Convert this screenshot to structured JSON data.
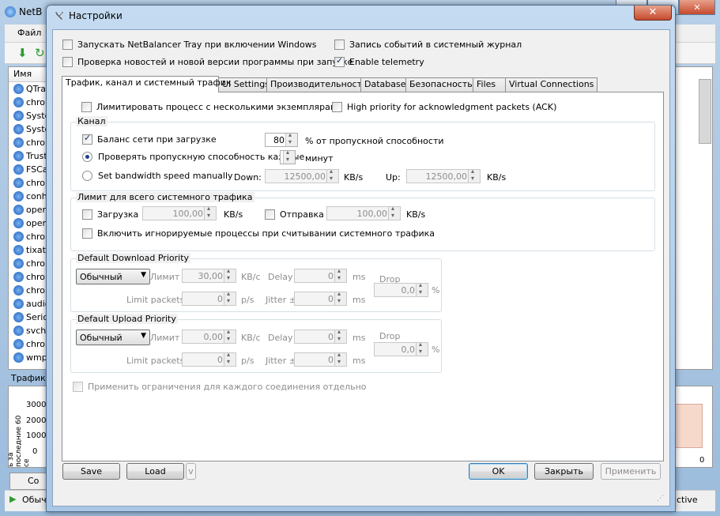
{
  "main_window": {
    "title": "NetB",
    "menu_file": "Файл",
    "list_header": "Имя",
    "processes": [
      "QTra",
      "chron",
      "Syste",
      "Syste",
      "chron",
      "Trust",
      "FSCa",
      "chron",
      "conh",
      "openv",
      "openv",
      "chron",
      "tixati",
      "chron",
      "chron",
      "chron",
      "audio",
      "Serio",
      "svch",
      "chron",
      "wmp"
    ],
    "traffic_label": "Трафик",
    "graph_vlabel": "ь за последние 60 се",
    "graph_ticks": [
      "3000",
      "2000",
      "1000",
      "0"
    ],
    "right_tick": "0",
    "status_left": "Обыч",
    "status_right": "ctive",
    "side_label": "Co"
  },
  "dialog": {
    "title": "Настройки",
    "close_glyph": "✕",
    "top_options": {
      "tray_start": {
        "label": "Запускать NetBalancer Tray при включении Windows",
        "checked": false
      },
      "event_log": {
        "label": "Запись событий в системный журнал",
        "checked": false
      },
      "check_news": {
        "label": "Проверка новостей и новой версии программы при запуске",
        "checked": false
      },
      "telemetry": {
        "label": "Enable telemetry",
        "checked": true
      }
    },
    "tabs": [
      {
        "label": "Трафик, канал и системный трафик",
        "active": true
      },
      {
        "label": "UI Settings",
        "active": false
      },
      {
        "label": "Производительность",
        "active": false
      },
      {
        "label": "Database",
        "active": false
      },
      {
        "label": "Безопасность",
        "active": false
      },
      {
        "label": "Files",
        "active": false
      },
      {
        "label": "Virtual Connections",
        "active": false
      }
    ],
    "tab_content": {
      "limit_multi": "Лимитировать процесс с несколькими экземплярами",
      "high_priority_ack": "High priority for acknowledgment packets (ACK)",
      "channel": {
        "title": "Канал",
        "balance_label": "Баланс сети при загрузке",
        "balance_value": "80",
        "balance_unit": "% от пропускной способности",
        "check_bw_label": "Проверять пропускную способность каждые",
        "check_bw_value": "",
        "check_bw_unit": "минут",
        "manual_label": "Set bandwidth speed manually",
        "down_label": "Down:",
        "down_value": "12500,00",
        "down_unit": "KB/s",
        "up_label": "Up:",
        "up_value": "12500,00",
        "up_unit": "KB/s"
      },
      "system_limit": {
        "title": "Лимит для всего системного трафика",
        "download_label": "Загрузка",
        "download_value": "100,00",
        "download_unit": "KB/s",
        "upload_label": "Отправка",
        "upload_value": "100,00",
        "upload_unit": "KB/s",
        "include_ignored": "Включить игнорируемые процессы при считывании системного трафика"
      },
      "download_priority": {
        "title": "Default Download Priority",
        "select": "Обычный",
        "limit_label": "Лимит",
        "limit_value": "30,00",
        "limit_unit": "KB/c",
        "delay_label": "Delay",
        "delay_value": "0",
        "delay_unit": "ms",
        "drop_label": "Drop",
        "drop_value": "0,0",
        "drop_unit": "%",
        "packets_label": "Limit packets",
        "packets_value": "0",
        "packets_unit": "p/s",
        "jitter_label": "Jitter ±",
        "jitter_value": "0",
        "jitter_unit": "ms"
      },
      "upload_priority": {
        "title": "Default Upload Priority",
        "select": "Обычный",
        "limit_label": "Лимит",
        "limit_value": "0,00",
        "limit_unit": "KB/c",
        "delay_label": "Delay",
        "delay_value": "0",
        "delay_unit": "ms",
        "drop_label": "Drop",
        "drop_value": "0,0",
        "drop_unit": "%",
        "packets_label": "Limit packets",
        "packets_value": "0",
        "packets_unit": "p/s",
        "jitter_label": "Jitter ±",
        "jitter_value": "0",
        "jitter_unit": "ms"
      },
      "per_connection": "Применить ограничения для каждого соединения отдельно"
    },
    "buttons": {
      "save": "Save",
      "load": "Load",
      "load_menu": "v",
      "ok": "OK",
      "close": "Закрыть",
      "apply": "Применить"
    }
  }
}
